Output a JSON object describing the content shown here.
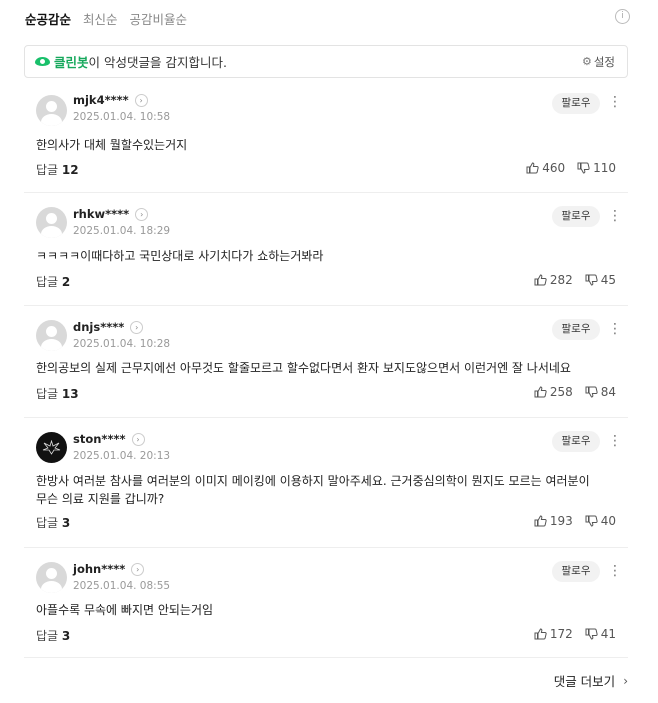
{
  "sort": {
    "tabs": [
      "순공감순",
      "최신순",
      "공감비율순"
    ],
    "active": 0
  },
  "info_icon": "info-icon",
  "cleanbot": {
    "brand": "클린봇",
    "message": "이 악성댓글을 감지합니다.",
    "settings_label": "설정",
    "icon": "eye-icon",
    "brand_color": "#16a85c"
  },
  "follow_label": "팔로우",
  "reply_label": "답글",
  "comments": [
    {
      "user": "mjk4****",
      "date": "2025.01.04. 10:58",
      "text": "한의사가 대체 뭘할수있는거지",
      "replies": "12",
      "likes": "460",
      "dislikes": "110",
      "avatar": "default"
    },
    {
      "user": "rhkw****",
      "date": "2025.01.04. 18:29",
      "text": "ㅋㅋㅋㅋ이때다하고 국민상대로 사기치다가 쇼하는거봐라",
      "replies": "2",
      "likes": "282",
      "dislikes": "45",
      "avatar": "default"
    },
    {
      "user": "dnjs****",
      "date": "2025.01.04. 10:28",
      "text": "한의공보의 실제 근무지에선 아무것도 할줄모르고 할수없다면서 환자 보지도않으면서 이런거엔 잘 나서네요",
      "replies": "13",
      "likes": "258",
      "dislikes": "84",
      "avatar": "default"
    },
    {
      "user": "ston****",
      "date": "2025.01.04. 20:13",
      "text": "한방사 여러분 참사를 여러분의 이미지 메이킹에 이용하지 말아주세요. 근거중심의학이 뭔지도 모르는 여러분이 무슨 의료 지원를 갑니까?",
      "replies": "3",
      "likes": "193",
      "dislikes": "40",
      "avatar": "custom"
    },
    {
      "user": "john****",
      "date": "2025.01.04. 08:55",
      "text": "아플수록 무속에 빠지면 안되는거임",
      "replies": "3",
      "likes": "172",
      "dislikes": "41",
      "avatar": "default"
    }
  ],
  "more_label": "댓글 더보기"
}
